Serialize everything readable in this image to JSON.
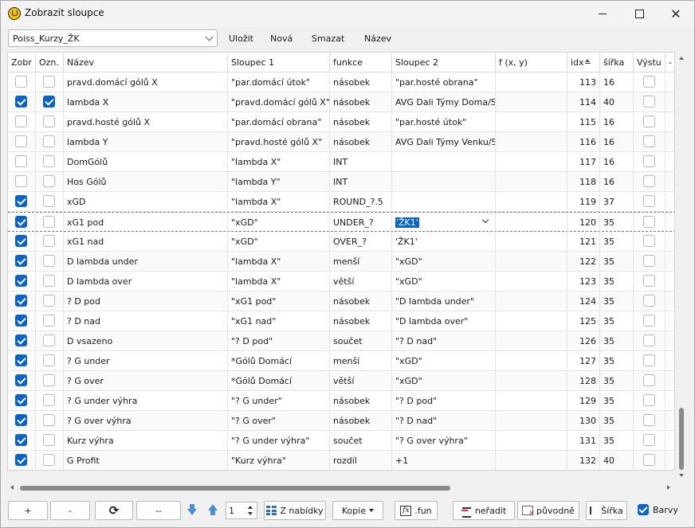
{
  "window": {
    "title": "Zobrazit sloupce",
    "close_glyph": "✕"
  },
  "toolbar": {
    "profile_value": "Poiss_Kurzy_ŽK",
    "save_label": "Uložit",
    "new_label": "Nová",
    "delete_label": "Smazat",
    "name_label": "Název"
  },
  "columns": [
    "Zobr",
    "Ozn.",
    "Název",
    "Sloupec 1",
    "funkce",
    "Sloupec 2",
    "f (x, y)",
    "idx",
    "šířka",
    "Výstu",
    "- v"
  ],
  "rows": [
    {
      "show": false,
      "mark": false,
      "name": "pravd.domácí gólů X",
      "col1": "\"par.domácí útok\"",
      "func": "násobek",
      "col2": "\"par.hosté obrana\"",
      "fxy": "",
      "idx": "113",
      "width": "16"
    },
    {
      "show": true,
      "mark": true,
      "name": "lambda X",
      "col1": "\"pravd.domácí gólů X\"",
      "func": "násobek",
      "col2": "AVG Dali Týmy Doma/Sc",
      "fxy": "",
      "idx": "114",
      "width": "40"
    },
    {
      "show": false,
      "mark": false,
      "name": "pravd.hosté gólů X",
      "col1": "\"par.domácí obrana\"",
      "func": "násobek",
      "col2": "\"par.hosté útok\"",
      "fxy": "",
      "idx": "115",
      "width": "16"
    },
    {
      "show": false,
      "mark": false,
      "name": "lambda Y",
      "col1": "\"pravd.hosté gólů X\"",
      "func": "násobek",
      "col2": "AVG Dali Týmy Venku/Sc",
      "fxy": "",
      "idx": "116",
      "width": "16"
    },
    {
      "show": false,
      "mark": false,
      "name": "DomGólů",
      "col1": "\"lambda X\"",
      "func": "INT",
      "col2": "",
      "fxy": "",
      "idx": "117",
      "width": "16"
    },
    {
      "show": false,
      "mark": false,
      "name": "Hos Gólů",
      "col1": "\"lambda Y\"",
      "func": "INT",
      "col2": "",
      "fxy": "",
      "idx": "118",
      "width": "16"
    },
    {
      "show": true,
      "mark": false,
      "name": "xGD",
      "col1": "\"lambda X\"",
      "func": "ROUND_?.5",
      "col2": "",
      "fxy": "",
      "idx": "119",
      "width": "37"
    },
    {
      "show": true,
      "mark": false,
      "name": "xG1 pod",
      "col1": "\"xGD\"",
      "func": "UNDER_?",
      "col2": "'ŽK1'",
      "fxy": "",
      "idx": "120",
      "width": "35",
      "selected": true
    },
    {
      "show": true,
      "mark": false,
      "name": "xG1 nad",
      "col1": "\"xGD\"",
      "func": "OVER_?",
      "col2": "'ŽK1'",
      "fxy": "",
      "idx": "121",
      "width": "35"
    },
    {
      "show": true,
      "mark": false,
      "name": "D lambda under",
      "col1": "\"lambda X\"",
      "func": "menší",
      "col2": "\"xGD\"",
      "fxy": "",
      "idx": "122",
      "width": "35"
    },
    {
      "show": true,
      "mark": false,
      "name": "D lambda over",
      "col1": "\"lambda X\"",
      "func": "větší",
      "col2": "\"xGD\"",
      "fxy": "",
      "idx": "123",
      "width": "35"
    },
    {
      "show": true,
      "mark": false,
      "name": "? D pod",
      "col1": "\"xG1 pod\"",
      "func": "násobek",
      "col2": "\"D lambda under\"",
      "fxy": "",
      "idx": "124",
      "width": "35"
    },
    {
      "show": true,
      "mark": false,
      "name": "? D nad",
      "col1": "\"xG1 nad\"",
      "func": "násobek",
      "col2": "\"D lambda over\"",
      "fxy": "",
      "idx": "125",
      "width": "35"
    },
    {
      "show": true,
      "mark": false,
      "name": "D vsazeno",
      "col1": "\"? D pod\"",
      "func": "součet",
      "col2": "\"? D nad\"",
      "fxy": "",
      "idx": "126",
      "width": "35"
    },
    {
      "show": true,
      "mark": false,
      "name": "? G under",
      "col1": "*Gólů Domácí",
      "func": "menší",
      "col2": "\"xGD\"",
      "fxy": "",
      "idx": "127",
      "width": "35"
    },
    {
      "show": true,
      "mark": false,
      "name": "? G over",
      "col1": "*Gólů Domácí",
      "func": "větší",
      "col2": "\"xGD\"",
      "fxy": "",
      "idx": "128",
      "width": "35"
    },
    {
      "show": true,
      "mark": false,
      "name": "? G under výhra",
      "col1": "\"? G under\"",
      "func": "násobek",
      "col2": "\"? D pod\"",
      "fxy": "",
      "idx": "129",
      "width": "35"
    },
    {
      "show": true,
      "mark": false,
      "name": "? G over výhra",
      "col1": "\"? G over\"",
      "func": "násobek",
      "col2": "\"? D nad\"",
      "fxy": "",
      "idx": "130",
      "width": "35"
    },
    {
      "show": true,
      "mark": false,
      "name": "Kurz výhra",
      "col1": "\"? G under výhra\"",
      "func": "součet",
      "col2": "\"? G over výhra\"",
      "fxy": "",
      "idx": "131",
      "width": "35"
    },
    {
      "show": true,
      "mark": false,
      "name": "G Profit",
      "col1": "\"Kurz výhra\"",
      "func": "rozdíl",
      "col2": "+1",
      "fxy": "",
      "idx": "132",
      "width": "40"
    }
  ],
  "bottom": {
    "add_label": "+",
    "remove_label": "-",
    "refresh_glyph": "⟳",
    "dashdash_label": "--",
    "spin_value": "1",
    "from_menu_label": "Z nabídky",
    "copy_label": "Kopie",
    "fun_label": ".fun",
    "fx_glyph": "fx",
    "nosort_label": "neřadit",
    "original_label": "původně",
    "width_label": "Šířka",
    "colors_label": "Barvy"
  },
  "colors": {
    "accent": "#0a64c8",
    "arrow": "#4a8fd8"
  }
}
